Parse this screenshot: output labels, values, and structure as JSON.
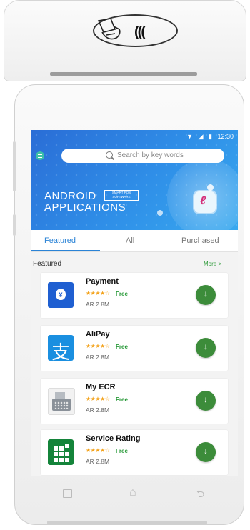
{
  "status_bar": {
    "time": "12:30"
  },
  "header": {
    "search_placeholder": "Search by key words",
    "brand_line1": "ANDROID",
    "brand_badge": "SMART POS SOFTWARE",
    "brand_line2": "APPLICATIONS"
  },
  "tabs": [
    {
      "label": "Featured",
      "active": true
    },
    {
      "label": "All",
      "active": false
    },
    {
      "label": "Purchased",
      "active": false
    }
  ],
  "section": {
    "title": "Featured",
    "more": "More >"
  },
  "apps": [
    {
      "name": "Payment",
      "rating_stars": "★★★★☆",
      "rating": 4,
      "price": "Free",
      "size": "AR 2.8M",
      "icon": "money-bag-icon",
      "color": "#1f5fd1"
    },
    {
      "name": "AliPay",
      "rating_stars": "★★★★☆",
      "rating": 4,
      "price": "Free",
      "size": "AR 2.8M",
      "icon": "alipay-icon",
      "color": "#1a8fe0"
    },
    {
      "name": "My ECR",
      "rating_stars": "★★★★☆",
      "rating": 4,
      "price": "Free",
      "size": "AR 2.8M",
      "icon": "cash-register-icon",
      "color": "#8a9199"
    },
    {
      "name": "Service Rating",
      "rating_stars": "★★★★☆",
      "rating": 4,
      "price": "Free",
      "size": "AR 2.8M",
      "icon": "service-grid-icon",
      "color": "#14843a"
    }
  ],
  "download_button": {
    "icon": "download-icon",
    "color": "#3c8c3a"
  },
  "icons": {
    "nfc": "((("
  }
}
